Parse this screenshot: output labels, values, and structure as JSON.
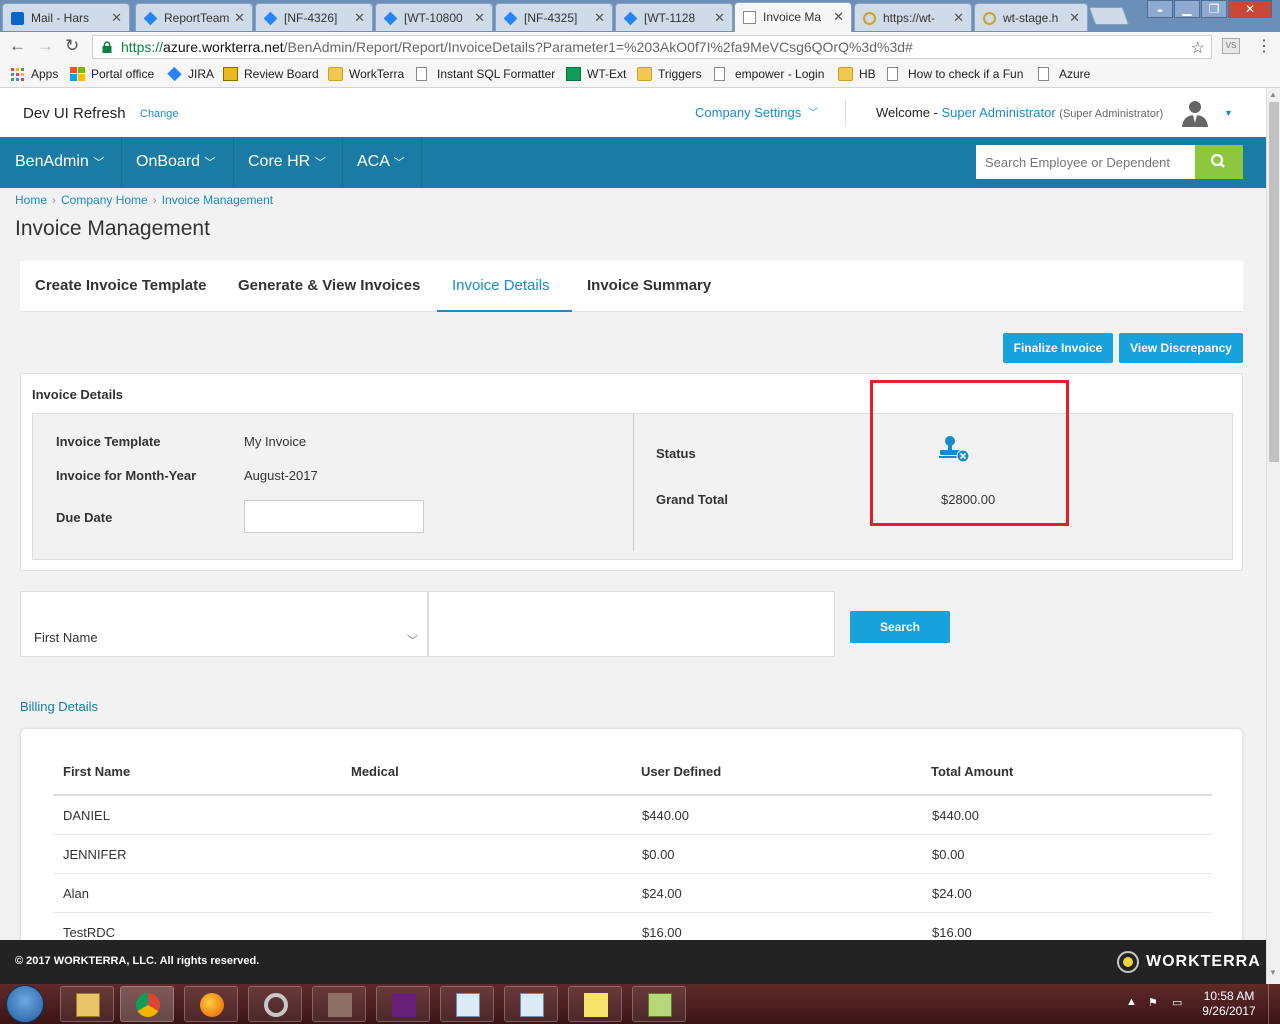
{
  "browser": {
    "tabs": [
      {
        "label": "Mail - Hars",
        "icon": "outlook-icon"
      },
      {
        "label": "ReportTeam",
        "icon": "diamond-icon"
      },
      {
        "label": "[NF-4326]",
        "icon": "diamond-icon"
      },
      {
        "label": "[WT-10800",
        "icon": "diamond-icon"
      },
      {
        "label": "[NF-4325]",
        "icon": "diamond-icon"
      },
      {
        "label": "[WT-1128",
        "icon": "diamond-icon"
      },
      {
        "label": "Invoice Ma",
        "icon": "page-icon"
      },
      {
        "label": "https://wt-",
        "icon": "loading-icon"
      },
      {
        "label": "wt-stage.h",
        "icon": "loading-icon"
      }
    ],
    "url": {
      "scheme": "https://",
      "host": "azure.workterra.net",
      "path": "/BenAdmin/Report/Report/InvoiceDetails?Parameter1=%203AkO0f7I%2fa9MeVCsg6QOrQ%3d%3d#"
    },
    "bookmarks": [
      {
        "label": "Apps",
        "icon": "apps-grid-icon"
      },
      {
        "label": "Portal office",
        "icon": "office-icon"
      },
      {
        "label": "JIRA",
        "icon": "jira-icon"
      },
      {
        "label": "Review Board",
        "icon": "review-board-icon"
      },
      {
        "label": "WorkTerra",
        "icon": "folder-icon"
      },
      {
        "label": "Instant SQL Formatter",
        "icon": "page-icon"
      },
      {
        "label": "WT-Ext",
        "icon": "sheet-icon"
      },
      {
        "label": "Triggers",
        "icon": "folder-icon"
      },
      {
        "label": "empower - Login",
        "icon": "page-icon"
      },
      {
        "label": "HB",
        "icon": "folder-icon"
      },
      {
        "label": "How to check if a Fun",
        "icon": "page-icon"
      },
      {
        "label": "Azure",
        "icon": "page-icon"
      }
    ]
  },
  "header": {
    "brand": "Dev UI Refresh",
    "change_label": "Change",
    "company_settings": "Company Settings",
    "welcome_prefix": "Welcome - ",
    "user_name": "Super Administrator",
    "user_role": "(Super Administrator)"
  },
  "nav": {
    "items": [
      "BenAdmin",
      "OnBoard",
      "Core HR",
      "ACA"
    ],
    "search_placeholder": "Search Employee or Dependent"
  },
  "breadcrumb": [
    "Home",
    "Company Home",
    "Invoice Management"
  ],
  "page_title": "Invoice Management",
  "page_tabs": [
    {
      "label": "Create Invoice Template",
      "active": false
    },
    {
      "label": "Generate & View Invoices",
      "active": false
    },
    {
      "label": "Invoice Details",
      "active": true
    },
    {
      "label": "Invoice Summary",
      "active": false
    }
  ],
  "actions": {
    "finalize": "Finalize Invoice",
    "discrepancy": "View Discrepancy"
  },
  "invoice_details": {
    "title": "Invoice Details",
    "template_label": "Invoice Template",
    "template_value": "My Invoice",
    "month_label": "Invoice for Month-Year",
    "month_value": "August-2017",
    "due_label": "Due Date",
    "due_value": "",
    "status_label": "Status",
    "status_icon": "user-stamp-unfinalized-icon",
    "grand_total_label": "Grand Total",
    "grand_total_value": "$2800.00"
  },
  "filter": {
    "field": "First Name",
    "value": "",
    "search_label": "Search"
  },
  "billing": {
    "title": "Billing Details",
    "columns": [
      "First Name",
      "Medical",
      "User Defined",
      "Total Amount"
    ],
    "rows": [
      {
        "first_name": "DANIEL",
        "medical": "",
        "user_defined": "$440.00",
        "total": "$440.00"
      },
      {
        "first_name": "JENNIFER",
        "medical": "",
        "user_defined": "$0.00",
        "total": "$0.00"
      },
      {
        "first_name": "Alan",
        "medical": "",
        "user_defined": "$24.00",
        "total": "$24.00"
      },
      {
        "first_name": "TestRDC",
        "medical": "",
        "user_defined": "$16.00",
        "total": "$16.00"
      }
    ]
  },
  "footer": {
    "copyright": "© 2017 WORKTERRA, LLC. All rights reserved.",
    "logo_text": "WORKTERRA"
  },
  "taskbar": {
    "time": "10:58 AM",
    "date": "9/26/2017"
  },
  "colors": {
    "nav_bg": "#1a7ca4",
    "accent": "#17a2dc",
    "search_go": "#8dc63f",
    "highlight": "#e3202a"
  }
}
